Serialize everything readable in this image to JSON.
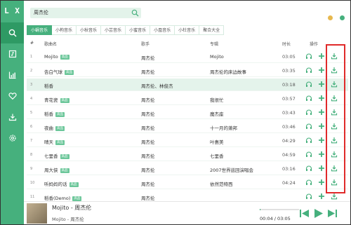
{
  "app": {
    "logo": "L X"
  },
  "sidebar": {
    "items": [
      "search-icon",
      "music-library-icon",
      "chart-icon",
      "heart-icon",
      "download-icon",
      "settings-icon"
    ]
  },
  "search": {
    "value": "周杰伦"
  },
  "window_controls": {
    "colors": [
      "#e7b84f",
      "#46b07d"
    ]
  },
  "tabs": [
    "小蜗音乐",
    "小枸音乐",
    "小秋音乐",
    "小芸音乐",
    "小蜜音乐",
    "小凰音乐",
    "小杜音乐",
    "聚合大全"
  ],
  "table": {
    "headers": {
      "num": "#",
      "name": "歌曲名",
      "artist": "歌手",
      "album": "专辑",
      "time": "时长",
      "ops": "操作"
    },
    "rows": [
      {
        "num": "1",
        "name": "Mojito",
        "badge": "高品",
        "artist": "周杰伦",
        "album": "Mojito",
        "time": "03:05"
      },
      {
        "num": "2",
        "name": "告白气球",
        "badge": "高品",
        "artist": "周杰伦",
        "album": "周杰伦的床边故事",
        "time": "03:35"
      },
      {
        "num": "3",
        "name": "稻香",
        "badge": "",
        "artist": "周杰伦、林俊杰",
        "album": "",
        "time": "03:18"
      },
      {
        "num": "4",
        "name": "青花瓷",
        "badge": "高品",
        "artist": "周杰伦",
        "album": "我很忙",
        "time": "03:57"
      },
      {
        "num": "5",
        "name": "稻香",
        "badge": "高品",
        "artist": "周杰伦",
        "album": "魔杰座",
        "time": "03:43"
      },
      {
        "num": "6",
        "name": "夜曲",
        "badge": "高品",
        "artist": "周杰伦",
        "album": "十一月的萧邦",
        "time": "03:46"
      },
      {
        "num": "7",
        "name": "晴天",
        "badge": "高品",
        "artist": "周杰伦",
        "album": "叶惠美",
        "time": "04:29"
      },
      {
        "num": "8",
        "name": "七里香",
        "badge": "高品",
        "artist": "周杰伦",
        "album": "七里香",
        "time": "04:59"
      },
      {
        "num": "9",
        "name": "周大侠",
        "badge": "高品",
        "artist": "周杰伦",
        "album": "2007世界巡回演唱会",
        "time": "03:16"
      },
      {
        "num": "10",
        "name": "听妈妈的话",
        "badge": "高品",
        "artist": "周杰伦",
        "album": "依然范特西",
        "time": "04:24"
      },
      {
        "num": "11",
        "name": "稻香(Demo)",
        "badge": "高品",
        "artist": "周杰伦",
        "album": "",
        "time": ""
      }
    ]
  },
  "player": {
    "title": "Mojito - 周杰伦",
    "subtitle": "Mojito - 周杰伦",
    "time": "00:04 / 03:05",
    "progress": 0.02
  },
  "colors": {
    "accent": "#46b07d",
    "highlight": "#e02a2a"
  }
}
